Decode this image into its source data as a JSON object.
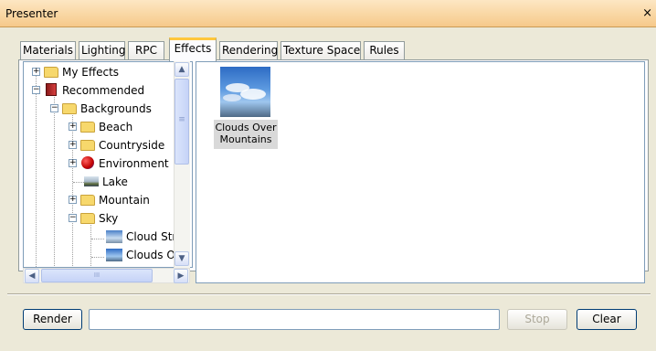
{
  "window": {
    "title": "Presenter",
    "close_glyph": "×"
  },
  "tabs": [
    {
      "label": "Materials"
    },
    {
      "label": "Lighting"
    },
    {
      "label": "RPC"
    },
    {
      "label": "Effects"
    },
    {
      "label": "Rendering"
    },
    {
      "label": "Texture Space"
    },
    {
      "label": "Rules"
    }
  ],
  "active_tab": "Effects",
  "tree": {
    "items": [
      {
        "label": "My Effects",
        "toggle": "+",
        "icon": "folder-icon"
      },
      {
        "label": "Recommended",
        "toggle": "−",
        "icon": "book-icon"
      },
      {
        "label": "Backgrounds",
        "toggle": "−",
        "icon": "folder-icon"
      },
      {
        "label": "Beach",
        "toggle": "+",
        "icon": "folder-icon"
      },
      {
        "label": "Countryside",
        "toggle": "+",
        "icon": "folder-icon"
      },
      {
        "label": "Environment",
        "toggle": "+",
        "icon": "environment-icon"
      },
      {
        "label": "Lake",
        "toggle": "",
        "icon": "lake-thumbnail-icon"
      },
      {
        "label": "Mountain",
        "toggle": "+",
        "icon": "folder-icon"
      },
      {
        "label": "Sky",
        "toggle": "−",
        "icon": "folder-icon"
      },
      {
        "label": "Cloud Stri",
        "toggle": "",
        "icon": "sky-thumbnail-icon"
      },
      {
        "label": "Clouds Ov",
        "toggle": "",
        "icon": "sky-thumbnail-icon"
      }
    ],
    "scroll_up_glyph": "▲",
    "scroll_down_glyph": "▼",
    "scroll_left_glyph": "◀",
    "scroll_right_glyph": "▶",
    "grip_glyph": "≡",
    "hgrip_glyph": "III"
  },
  "gallery": {
    "items": [
      {
        "label": "Clouds Over Mountains"
      }
    ]
  },
  "footer": {
    "render_label": "Render",
    "status_value": "",
    "stop_label": "Stop",
    "clear_label": "Clear"
  }
}
